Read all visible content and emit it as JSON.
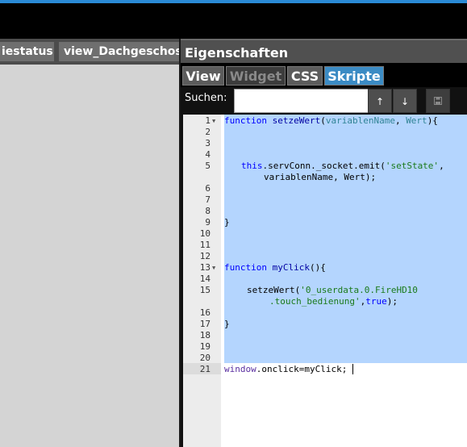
{
  "view_tabs": [
    "iestatus",
    "view_Dachgeschoss"
  ],
  "panel": {
    "title": "Eigenschaften",
    "tabs": [
      {
        "label": "View",
        "state": "normal"
      },
      {
        "label": "Widget",
        "state": "disabled"
      },
      {
        "label": "CSS",
        "state": "normal"
      },
      {
        "label": "Skripte",
        "state": "active"
      }
    ],
    "search": {
      "label": "Suchen:",
      "value": "",
      "up_icon": "arrow-up-icon",
      "down_icon": "arrow-down-icon",
      "save_icon": "save-icon"
    }
  },
  "editor": {
    "active_line": 21,
    "lines": [
      {
        "n": "1",
        "fold": true
      },
      {
        "n": "2"
      },
      {
        "n": "3"
      },
      {
        "n": "4"
      },
      {
        "n": "5"
      },
      {
        "n": "6"
      },
      {
        "n": "7"
      },
      {
        "n": "8"
      },
      {
        "n": "9"
      },
      {
        "n": "10"
      },
      {
        "n": "11"
      },
      {
        "n": "12"
      },
      {
        "n": "13",
        "fold": true
      },
      {
        "n": "14"
      },
      {
        "n": "15"
      },
      {
        "n": "16"
      },
      {
        "n": "17"
      },
      {
        "n": "18"
      },
      {
        "n": "19"
      },
      {
        "n": "20"
      },
      {
        "n": "21"
      }
    ],
    "code": {
      "l1_kw": "function",
      "l1_name": "setzeWert",
      "l1_open": "(",
      "l1_p1": "variablenName",
      "l1_comma": ", ",
      "l1_p2": "Wert",
      "l1_close": "){",
      "l5_this": "this",
      "l5_rest": ".servConn._socket.emit(",
      "l5_str": "'setState'",
      "l5_end": ",",
      "l5b": "variablenName, Wert);",
      "l9": "}",
      "l13_kw": "function",
      "l13_name": "myClick",
      "l13_rest": "(){",
      "l15_call": "setzeWert(",
      "l15_str": "'0_userdata.0.FireHD10",
      "l15b_str": ".touch_bedienung'",
      "l15b_comma": ",",
      "l15b_bool": "true",
      "l15b_end": ");",
      "l17": "}",
      "l21_obj": "window",
      "l21_rest": ".onclick=myClick;"
    }
  }
}
